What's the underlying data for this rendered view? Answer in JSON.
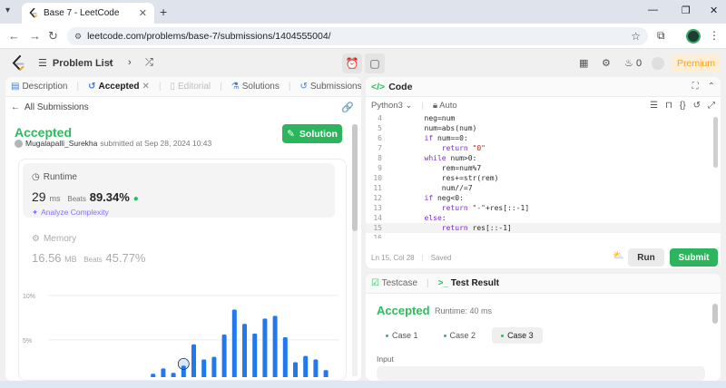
{
  "browser": {
    "tab_title": "Base 7 - LeetCode",
    "url": "leetcode.com/problems/base-7/submissions/1404555004/"
  },
  "nav": {
    "problem_list": "Problem List",
    "streak_count": "0",
    "premium": "Premium"
  },
  "left_tabs": [
    {
      "label": "Description",
      "state": "normal"
    },
    {
      "label": "Accepted",
      "state": "active"
    },
    {
      "label": "Editorial",
      "state": "disabled"
    },
    {
      "label": "Solutions",
      "state": "normal"
    },
    {
      "label": "Submissions",
      "state": "normal"
    }
  ],
  "submission": {
    "back_link": "All Submissions",
    "status": "Accepted",
    "user": "Mugalapalli_Surekha",
    "submitted_text": "submitted at Sep 28, 2024 10:43",
    "solution_button": "Solution",
    "runtime_label": "Runtime",
    "runtime_value": "29",
    "runtime_unit": "ms",
    "beats_label": "Beats",
    "runtime_beats": "89.34%",
    "analyze": "Analyze Complexity",
    "memory_label": "Memory",
    "memory_value": "16.56",
    "memory_unit": "MB",
    "memory_beats": "45.77%"
  },
  "chart_data": {
    "type": "bar",
    "y_ticks": [
      "10%",
      "5%"
    ],
    "ylim": [
      0,
      10
    ],
    "values": [
      0.3,
      1.2,
      1.8,
      1.3,
      2.1,
      4.5,
      2.8,
      3.1,
      5.6,
      8.4,
      6.8,
      5.7,
      7.4,
      7.7,
      5.3,
      2.5,
      3.2,
      2.8,
      1.6
    ],
    "highlight_index": 4,
    "color": "#2079ee"
  },
  "code": {
    "title": "Code",
    "language": "Python3",
    "mode": "Auto",
    "lines": [
      {
        "n": "4",
        "t": "        neg=num"
      },
      {
        "n": "5",
        "t": "        num=abs(num)"
      },
      {
        "n": "6",
        "t": "        if num==0:"
      },
      {
        "n": "7",
        "t": "            return \"0\""
      },
      {
        "n": "8",
        "t": "        while num>0:"
      },
      {
        "n": "9",
        "t": "            rem=num%7"
      },
      {
        "n": "10",
        "t": "            res+=str(rem)"
      },
      {
        "n": "11",
        "t": "            num//=7"
      },
      {
        "n": "12",
        "t": "        if neg<0:"
      },
      {
        "n": "13",
        "t": "            return \"-\"+res[::-1]"
      },
      {
        "n": "14",
        "t": "        else:"
      },
      {
        "n": "15",
        "t": "            return res[::-1]"
      },
      {
        "n": "16",
        "t": ""
      }
    ],
    "cursor": "Ln 15, Col 28",
    "saved": "Saved",
    "run": "Run",
    "submit": "Submit"
  },
  "result": {
    "testcase_tab": "Testcase",
    "result_tab": "Test Result",
    "status": "Accepted",
    "runtime": "Runtime: 40 ms",
    "cases": [
      "Case 1",
      "Case 2",
      "Case 3"
    ],
    "active_case": 2,
    "input_label": "Input"
  }
}
